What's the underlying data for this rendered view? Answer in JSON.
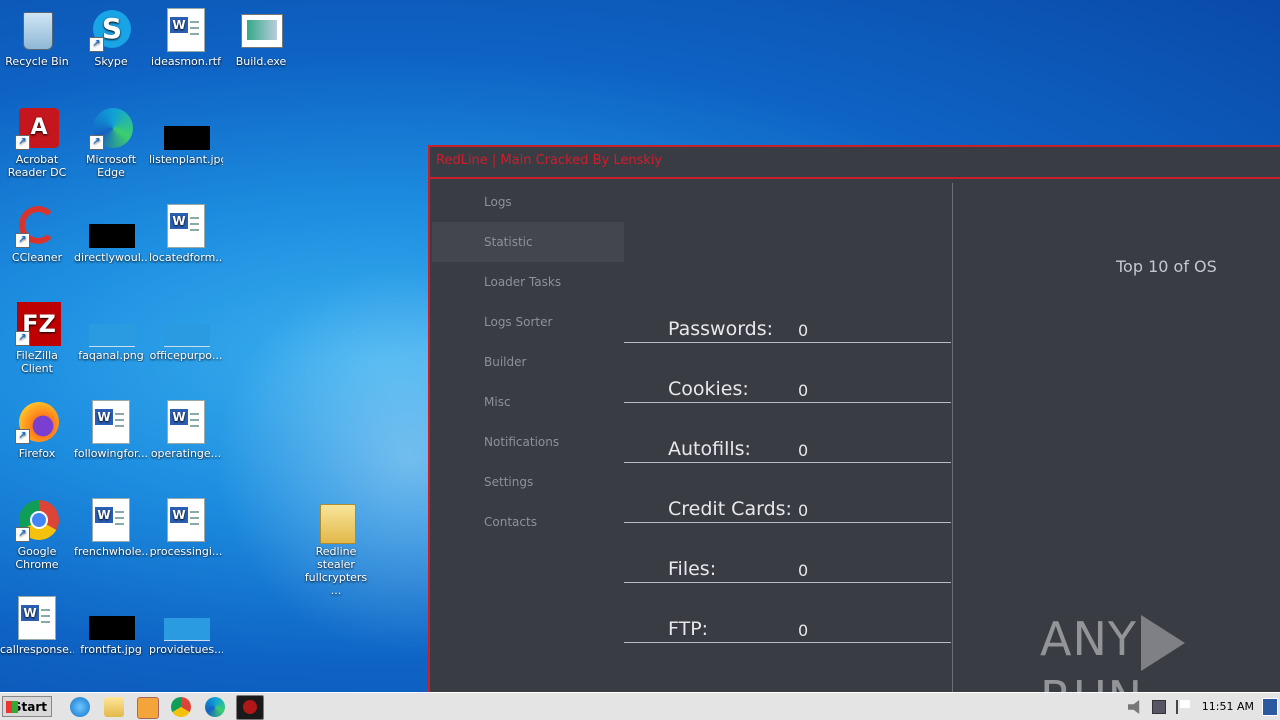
{
  "desktop": {
    "icons": [
      {
        "label": "Recycle Bin",
        "icon": "recycle-bin-icon"
      },
      {
        "label": "Skype",
        "icon": "skype-icon"
      },
      {
        "label": "ideasmon.rtf",
        "icon": "word-document-icon"
      },
      {
        "label": "Build.exe",
        "icon": "exe-window-icon"
      },
      {
        "label": "Acrobat Reader DC",
        "icon": "acrobat-icon"
      },
      {
        "label": "Microsoft Edge",
        "icon": "edge-icon"
      },
      {
        "label": "listenplant.jpg",
        "icon": "image-file-icon"
      },
      {
        "label": "CCleaner",
        "icon": "ccleaner-icon"
      },
      {
        "label": "directlywoul...",
        "icon": "image-file-icon"
      },
      {
        "label": "locatedform...",
        "icon": "word-document-icon"
      },
      {
        "label": "FileZilla Client",
        "icon": "filezilla-icon"
      },
      {
        "label": "faqanal.png",
        "icon": "image-file-icon"
      },
      {
        "label": "officepurpo...",
        "icon": "image-file-icon"
      },
      {
        "label": "Firefox",
        "icon": "firefox-icon"
      },
      {
        "label": "followingfor...",
        "icon": "word-document-icon"
      },
      {
        "label": "operatinge...",
        "icon": "word-document-icon"
      },
      {
        "label": "Google Chrome",
        "icon": "chrome-icon"
      },
      {
        "label": "frenchwhole...",
        "icon": "word-document-icon"
      },
      {
        "label": "processingi...",
        "icon": "word-document-icon"
      },
      {
        "label": "Redline stealer fullcrypters ...",
        "icon": "folder-icon"
      },
      {
        "label": "callresponse...",
        "icon": "word-document-icon"
      },
      {
        "label": "frontfat.jpg",
        "icon": "image-file-icon"
      },
      {
        "label": "providetues...",
        "icon": "image-file-icon"
      }
    ]
  },
  "app": {
    "title": "RedLine | Main Cracked By Lenskiy",
    "nav": [
      "Logs",
      "Statistic",
      "Loader Tasks",
      "Logs Sorter",
      "Builder",
      "Misc",
      "Notifications",
      "Settings",
      "Contacts"
    ],
    "active_nav": "Statistic",
    "stats": [
      {
        "name": "Passwords:",
        "value": "0"
      },
      {
        "name": "Cookies:",
        "value": "0"
      },
      {
        "name": "Autofills:",
        "value": "0"
      },
      {
        "name": "Credit Cards:",
        "value": "0"
      },
      {
        "name": "Files:",
        "value": "0"
      },
      {
        "name": "FTP:",
        "value": "0"
      }
    ],
    "os_panel_title": "Top 10 of OS"
  },
  "watermark": {
    "left": "ANY",
    "right": "RUN"
  },
  "taskbar": {
    "start_label": "Start",
    "clock": "11:51 AM",
    "pinned": [
      "ie-icon",
      "explorer-icon",
      "media-player-icon",
      "chrome-icon",
      "edge-icon",
      "redline-icon"
    ]
  },
  "colors": {
    "accent": "#c8202a",
    "window_bg": "#3a3c44"
  }
}
